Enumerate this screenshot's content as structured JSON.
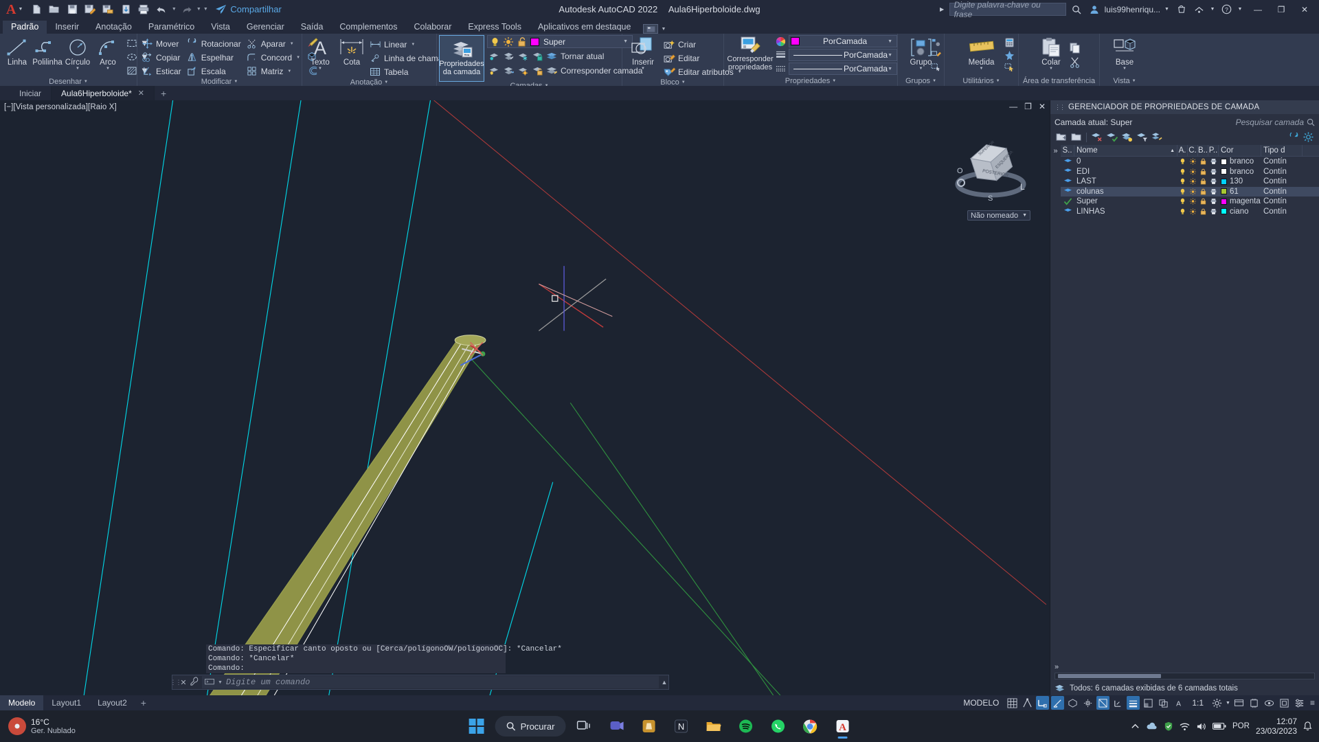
{
  "titlebar": {
    "app_title": "Autodesk AutoCAD 2022",
    "file_name": "Aula6Hiperboloide.dwg",
    "share_label": "Compartilhar",
    "search_placeholder": "Digite palavra-chave ou frase",
    "user_name": "luis99henriqu...",
    "qat": [
      {
        "name": "new-file-icon",
        "label": "Novo"
      },
      {
        "name": "open-file-icon",
        "label": "Abrir"
      },
      {
        "name": "save-icon",
        "label": "Salvar"
      },
      {
        "name": "save-as-icon",
        "label": "Salvar como"
      },
      {
        "name": "save-cloud-icon",
        "label": "Salvar no Web e Mobile"
      },
      {
        "name": "open-cloud-icon",
        "label": "Abrir no Web e Mobile"
      },
      {
        "name": "plot-icon",
        "label": "Plotar"
      },
      {
        "name": "undo-icon",
        "label": "Desfazer"
      },
      {
        "name": "redo-icon",
        "label": "Refazer"
      }
    ],
    "window_controls": {
      "minimize": "—",
      "maximize": "❐",
      "close": "✕"
    }
  },
  "ribbon": {
    "tabs": [
      {
        "label": "Padrão",
        "active": true
      },
      {
        "label": "Inserir",
        "active": false
      },
      {
        "label": "Anotação",
        "active": false
      },
      {
        "label": "Paramétrico",
        "active": false
      },
      {
        "label": "Vista",
        "active": false
      },
      {
        "label": "Gerenciar",
        "active": false
      },
      {
        "label": "Saída",
        "active": false
      },
      {
        "label": "Complementos",
        "active": false
      },
      {
        "label": "Colaborar",
        "active": false
      },
      {
        "label": "Express Tools",
        "active": false
      },
      {
        "label": "Aplicativos em destaque",
        "active": false
      }
    ],
    "panels": {
      "desenhar": {
        "title": "Desenhar",
        "big": [
          {
            "label": "Linha",
            "icon": "line-icon"
          },
          {
            "label": "Polilinha",
            "icon": "polyline-icon"
          },
          {
            "label": "Círculo",
            "icon": "circle-icon",
            "has_dropdown": true
          },
          {
            "label": "Arco",
            "icon": "arc-icon",
            "has_dropdown": true
          }
        ],
        "small_icons": [
          {
            "name": "rectangle-icon",
            "label": "Retângulo"
          },
          {
            "name": "ellipse-icon",
            "label": "Elipse"
          },
          {
            "name": "hatch-icon",
            "label": "Hachura"
          }
        ]
      },
      "modificar": {
        "title": "Modificar",
        "items": [
          {
            "label": "Mover",
            "icon": "move-icon"
          },
          {
            "label": "Rotacionar",
            "icon": "rotate-icon"
          },
          {
            "label": "Aparar",
            "icon": "trim-icon",
            "has_dropdown": true
          },
          {
            "label": "Copiar",
            "icon": "copy-icon"
          },
          {
            "label": "Espelhar",
            "icon": "mirror-icon"
          },
          {
            "label": "Concord",
            "icon": "fillet-icon",
            "has_dropdown": true
          },
          {
            "label": "Esticar",
            "icon": "stretch-icon"
          },
          {
            "label": "Escala",
            "icon": "scale-icon"
          },
          {
            "label": "Matriz",
            "icon": "array-icon",
            "has_dropdown": true
          }
        ],
        "side_icons": [
          {
            "name": "brush-icon"
          },
          {
            "name": "3d-solid-icon"
          },
          {
            "name": "offset-icon"
          }
        ]
      },
      "anotacao": {
        "title": "Anotação",
        "big": [
          {
            "label": "Texto",
            "icon": "text-icon",
            "has_dropdown": true
          },
          {
            "label": "Cota",
            "icon": "dimension-icon"
          }
        ],
        "items": [
          {
            "label": "Linear",
            "icon": "linear-dim-icon",
            "has_dropdown": true
          },
          {
            "label": "Linha de chamada",
            "icon": "leader-icon",
            "has_dropdown": true
          },
          {
            "label": "Tabela",
            "icon": "table-icon"
          }
        ]
      },
      "camadas": {
        "title": "Camadas",
        "big": {
          "label_line1": "Propriedades",
          "label_line2": "da camada",
          "icon": "layer-properties-icon",
          "active": true
        },
        "current_layer": "Super",
        "current_layer_color": "#ff00ff",
        "toggle_icons": [
          {
            "name": "lightbulb-icon"
          },
          {
            "name": "sun-icon"
          },
          {
            "name": "unlock-icon"
          }
        ],
        "items": [
          {
            "label": "Tornar atual",
            "icon": "make-current-icon"
          },
          {
            "label": "Corresponder camada",
            "icon": "match-layer-icon"
          }
        ],
        "grid_icons": [
          {
            "name": "layer-isolate-icon"
          },
          {
            "name": "layer-off-icon"
          },
          {
            "name": "layer-freeze-icon"
          },
          {
            "name": "layer-lock-icon"
          },
          {
            "name": "layer-unisolate-icon"
          },
          {
            "name": "layer-on-icon"
          },
          {
            "name": "layer-thaw-icon"
          },
          {
            "name": "layer-unlock-icon"
          }
        ]
      },
      "bloco": {
        "title": "Bloco",
        "big": {
          "label": "Inserir",
          "icon": "insert-block-icon",
          "has_dropdown": true
        },
        "items": [
          {
            "label": "Criar",
            "icon": "create-block-icon"
          },
          {
            "label": "Editar",
            "icon": "edit-block-icon"
          },
          {
            "label": "Editar atributos",
            "icon": "edit-attributes-icon",
            "has_dropdown": true
          }
        ]
      },
      "propriedades": {
        "title": "Propriedades",
        "big": {
          "label_line1": "Corresponder",
          "label_line2": "propriedades",
          "icon": "match-properties-icon"
        },
        "color_value": "PorCamada",
        "color_swatch": "#ff00ff",
        "linetype_value": "PorCamada",
        "lineweight_value": "PorCamada",
        "icons": [
          {
            "name": "color-wheel-icon"
          },
          {
            "name": "lineweight-icon"
          },
          {
            "name": "linetype-icon"
          }
        ]
      },
      "grupos": {
        "title": "Grupos",
        "big": {
          "label": "Grupo",
          "icon": "group-icon",
          "has_dropdown": true
        },
        "side_icons": [
          {
            "name": "ungroup-icon"
          },
          {
            "name": "group-edit-icon"
          },
          {
            "name": "group-select-icon"
          }
        ]
      },
      "utilitarios": {
        "title": "Utilitários",
        "big": {
          "label": "Medida",
          "icon": "measure-icon",
          "has_dropdown": true
        },
        "side_icons": [
          {
            "name": "quick-calc-icon"
          },
          {
            "name": "id-point-icon"
          },
          {
            "name": "quick-select-icon"
          }
        ]
      },
      "area_transferencia": {
        "title": "Área de transferência",
        "big": {
          "label": "Colar",
          "icon": "paste-icon",
          "has_dropdown": true
        },
        "side_icons": [
          {
            "name": "copy-clip-icon"
          },
          {
            "name": "cut-clip-icon"
          }
        ]
      },
      "vista": {
        "title": "Vista",
        "big": {
          "label": "Base",
          "icon": "base-view-icon",
          "has_dropdown": true
        }
      }
    }
  },
  "file_tabs": {
    "tabs": [
      {
        "label": "Iniciar",
        "active": false,
        "closable": false
      },
      {
        "label": "Aula6Hiperboloide*",
        "active": true,
        "closable": true
      }
    ],
    "add_label": "+"
  },
  "canvas": {
    "viewport_label": "[−][Vista personalizada][Raio X]",
    "viewcube_name": "Não nomeado",
    "viewcube_faces": [
      "POSTERIOR",
      "ESQUERDA",
      "SUPERIOR"
    ],
    "viewcube_compass": [
      "O",
      "L",
      "S"
    ],
    "window_buttons": {
      "minimize": "—",
      "restore": "❐",
      "close": "✕"
    }
  },
  "command_window": {
    "history": [
      "Comando: Especificar canto oposto ou [Cerca/polígonoOW/polígonoOC]: *Cancelar*",
      "Comando: *Cancelar*",
      "Comando:"
    ],
    "placeholder": "Digite um comando"
  },
  "layer_palette": {
    "title": "GERENCIADOR DE PROPRIEDADES DE CAMADA",
    "current_layer_label": "Camada atual: Super",
    "search_placeholder": "Pesquisar camada",
    "toolbar_icons": [
      {
        "name": "new-layer-icon"
      },
      {
        "name": "new-layer-vp-frozen-icon"
      },
      {
        "name": "delete-layer-icon"
      },
      {
        "name": "set-current-layer-icon"
      },
      {
        "name": "layer-states-icon"
      },
      {
        "name": "layer-filter-icon"
      },
      {
        "name": "layer-merge-icon"
      },
      {
        "name": "refresh-icon"
      },
      {
        "name": "settings-gear-icon"
      }
    ],
    "columns": [
      "S..",
      "Nome",
      "A.",
      "C.",
      "B..",
      "P..",
      "Cor",
      "Tipo d"
    ],
    "rows": [
      {
        "status": "layer-icon",
        "name": "0",
        "on": "on",
        "freeze": "sun",
        "lock": "locked",
        "plot": "plot",
        "color_name": "branco",
        "color": "#ffffff",
        "linetype": "Contín",
        "selected": false,
        "current": false
      },
      {
        "status": "layer-icon",
        "name": "EDI",
        "on": "on",
        "freeze": "sun",
        "lock": "locked",
        "plot": "plot",
        "color_name": "branco",
        "color": "#ffffff",
        "linetype": "Contín",
        "selected": false,
        "current": false
      },
      {
        "status": "layer-icon",
        "name": "LAST",
        "on": "on",
        "freeze": "sun",
        "lock": "locked",
        "plot": "plot",
        "color_name": "130",
        "color": "#00d2ff",
        "linetype": "Contín",
        "selected": false,
        "current": false
      },
      {
        "status": "layer-icon",
        "name": "colunas",
        "on": "on",
        "freeze": "sun",
        "lock": "locked",
        "plot": "plot",
        "color_name": "61",
        "color": "#a8c832",
        "linetype": "Contín",
        "selected": true,
        "current": false
      },
      {
        "status": "check-icon",
        "name": "Super",
        "on": "on",
        "freeze": "sun",
        "lock": "locked",
        "plot": "plot",
        "color_name": "magenta",
        "color": "#ff00ff",
        "linetype": "Contín",
        "selected": false,
        "current": true
      },
      {
        "status": "layer-icon",
        "name": "LINHAS",
        "on": "on",
        "freeze": "sun",
        "lock": "locked",
        "plot": "plot",
        "color_name": "ciano",
        "color": "#00ffff",
        "linetype": "Contín",
        "selected": false,
        "current": false
      }
    ],
    "status_text": "Todos: 6 camadas exibidas de 6 camadas totais"
  },
  "layout_tabs": {
    "tabs": [
      {
        "label": "Modelo",
        "active": true
      },
      {
        "label": "Layout1",
        "active": false
      },
      {
        "label": "Layout2",
        "active": false
      }
    ],
    "add_label": "+"
  },
  "statusbar": {
    "model_label": "MODELO",
    "scale_label": "1:1",
    "left_icons": [
      {
        "name": "model-space-icon"
      },
      {
        "name": "grid-display-icon",
        "on": false
      },
      {
        "name": "snap-mode-icon",
        "on": false
      },
      {
        "name": "ortho-mode-icon",
        "on": true
      },
      {
        "name": "polar-tracking-icon",
        "on": true
      },
      {
        "name": "isometric-draft-icon",
        "on": false
      },
      {
        "name": "object-snap-tracking-icon",
        "on": false
      },
      {
        "name": "osnap-icon",
        "on": true
      },
      {
        "name": "lineweight-display-icon",
        "on": true
      },
      {
        "name": "transparency-icon",
        "on": false
      },
      {
        "name": "selection-cycling-icon",
        "on": false
      },
      {
        "name": "3d-osnap-icon",
        "on": false
      },
      {
        "name": "dynamic-ucs-icon",
        "on": false
      },
      {
        "name": "annotation-scale-icon",
        "on": false
      }
    ],
    "right_icons": [
      {
        "name": "annotation-visibility-icon"
      },
      {
        "name": "autoscale-icon"
      },
      {
        "name": "workspace-switch-icon"
      },
      {
        "name": "hardware-accel-icon"
      },
      {
        "name": "isolate-objects-icon"
      },
      {
        "name": "cleanscreen-icon"
      },
      {
        "name": "customization-icon"
      }
    ]
  },
  "taskbar": {
    "weather_temp": "16°C",
    "weather_desc": "Ger. Nublado",
    "search_label": "Procurar",
    "apps": [
      {
        "name": "start-button-icon"
      },
      {
        "name": "search-pill"
      },
      {
        "name": "task-view-icon"
      },
      {
        "name": "teams-icon"
      },
      {
        "name": "store-icon"
      },
      {
        "name": "notion-icon"
      },
      {
        "name": "file-explorer-icon"
      },
      {
        "name": "spotify-icon"
      },
      {
        "name": "whatsapp-icon"
      },
      {
        "name": "chrome-icon"
      },
      {
        "name": "autocad-icon"
      }
    ],
    "tray": {
      "language": "POR",
      "time": "12:07",
      "date": "23/03/2023",
      "icons": [
        {
          "name": "show-hidden-icons"
        },
        {
          "name": "onedrive-icon"
        },
        {
          "name": "security-icon"
        },
        {
          "name": "wifi-icon"
        },
        {
          "name": "volume-icon"
        },
        {
          "name": "battery-icon"
        },
        {
          "name": "notifications-icon"
        }
      ]
    }
  }
}
